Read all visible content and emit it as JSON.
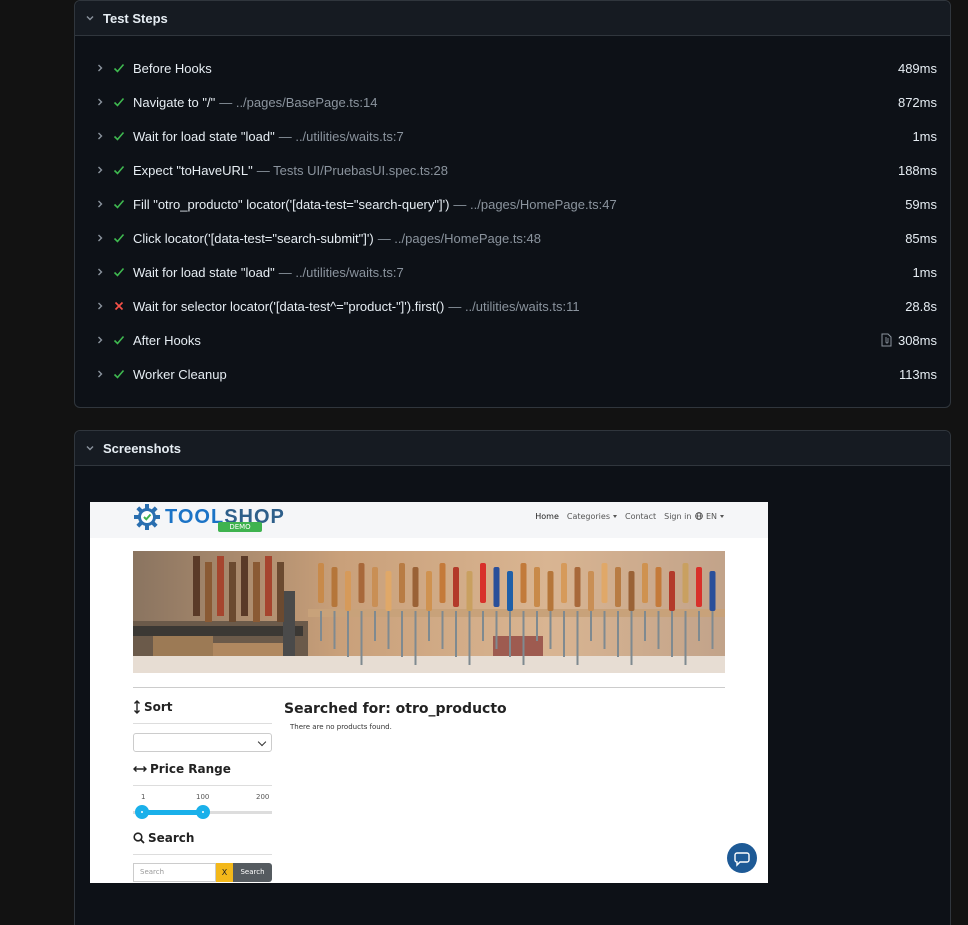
{
  "test_steps": {
    "header": "Test Steps",
    "steps": [
      {
        "title": "Before Hooks",
        "location": "",
        "duration": "489ms",
        "status": "passed"
      },
      {
        "title": "Navigate to \"/\"",
        "location": "— ../pages/BasePage.ts:14",
        "duration": "872ms",
        "status": "passed"
      },
      {
        "title": "Wait for load state \"load\"",
        "location": "— ../utilities/waits.ts:7",
        "duration": "1ms",
        "status": "passed"
      },
      {
        "title": "Expect \"toHaveURL\"",
        "location": "— Tests UI/PruebasUI.spec.ts:28",
        "duration": "188ms",
        "status": "passed"
      },
      {
        "title": "Fill \"otro_producto\" locator('[data-test=\"search-query\"]')",
        "location": "— ../pages/HomePage.ts:47",
        "duration": "59ms",
        "status": "passed"
      },
      {
        "title": "Click locator('[data-test=\"search-submit\"]')",
        "location": "— ../pages/HomePage.ts:48",
        "duration": "85ms",
        "status": "passed"
      },
      {
        "title": "Wait for load state \"load\"",
        "location": "— ../utilities/waits.ts:7",
        "duration": "1ms",
        "status": "passed"
      },
      {
        "title": "Wait for selector locator('[data-test^=\"product-\"]').first()",
        "location": "— ../utilities/waits.ts:11",
        "duration": "28.8s",
        "status": "failed"
      },
      {
        "title": "After Hooks",
        "location": "",
        "duration": "308ms",
        "status": "passed",
        "attachment": true
      },
      {
        "title": "Worker Cleanup",
        "location": "",
        "duration": "113ms",
        "status": "passed"
      }
    ]
  },
  "screenshots": {
    "header": "Screenshots",
    "app": {
      "logo_tool": "TOOL",
      "logo_shop": "SHOP",
      "logo_badge": "DEMO",
      "nav": {
        "home": "Home",
        "categories": "Categories",
        "contact": "Contact",
        "sign_in": "Sign in",
        "language": "EN"
      },
      "sort_heading": "Sort",
      "price_heading": "Price Range",
      "price_min": "1",
      "price_mid": "100",
      "price_max": "200",
      "price_range_selected": [
        1,
        100
      ],
      "search_heading": "Search",
      "search_placeholder": "Search",
      "search_clear": "X",
      "search_button": "Search",
      "result_title": "Searched for: otro_producto",
      "result_message": "There are no products found."
    }
  },
  "colors": {
    "passed": "#3fb950",
    "failed": "#f85149",
    "accent": "#1ab0ea"
  }
}
